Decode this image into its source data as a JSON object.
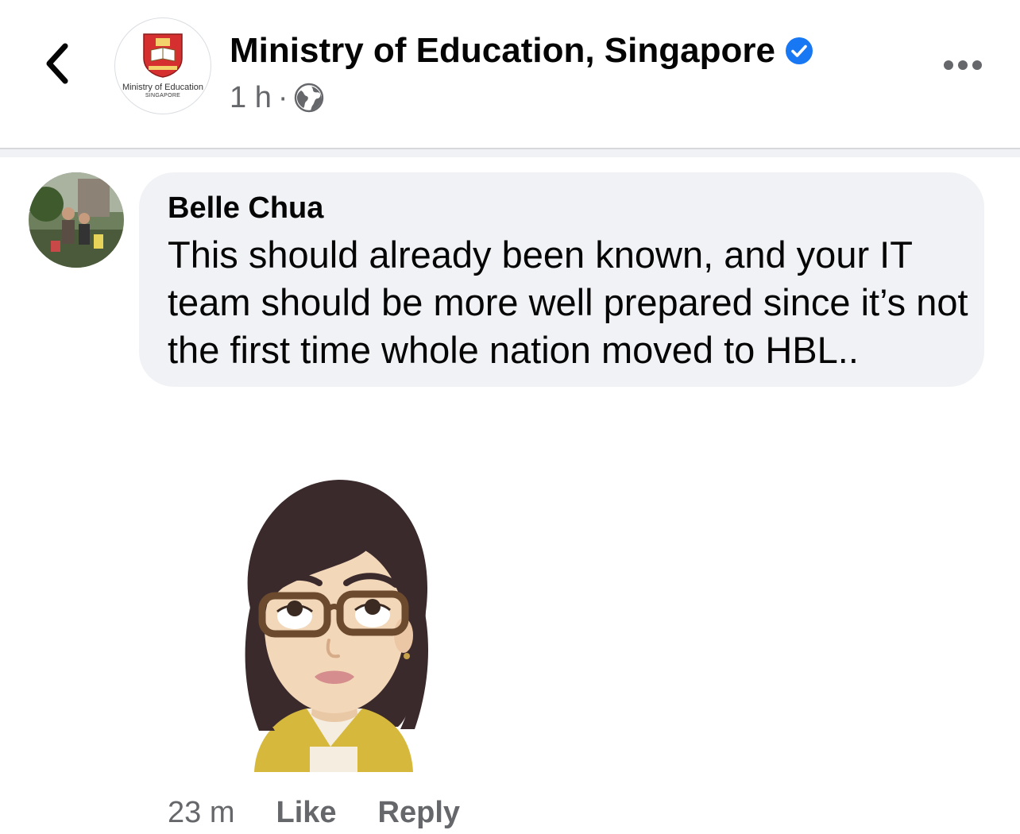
{
  "header": {
    "back_icon": "chevron-left-icon",
    "page_name": "Ministry of Education, Singapore",
    "verified_icon": "verified-badge-icon",
    "verified_color": "#1877f2",
    "timestamp": "1 h",
    "separator": "·",
    "audience_icon": "globe-icon",
    "more_icon": "ellipsis-icon",
    "avatar": {
      "line1": "Ministry of Education",
      "line2": "SINGAPORE"
    }
  },
  "comment": {
    "author": "Belle Chua",
    "text": "This should already been known, and your IT team should be more well prepared since it’s not the first time whole nation moved to HBL..",
    "sticker": "eye-roll-avatar-sticker",
    "age": "23 m",
    "like_label": "Like",
    "reply_label": "Reply"
  },
  "colors": {
    "bubble_bg": "#f0f2f5",
    "secondary_text": "#65676b",
    "primary_text": "#050505"
  }
}
